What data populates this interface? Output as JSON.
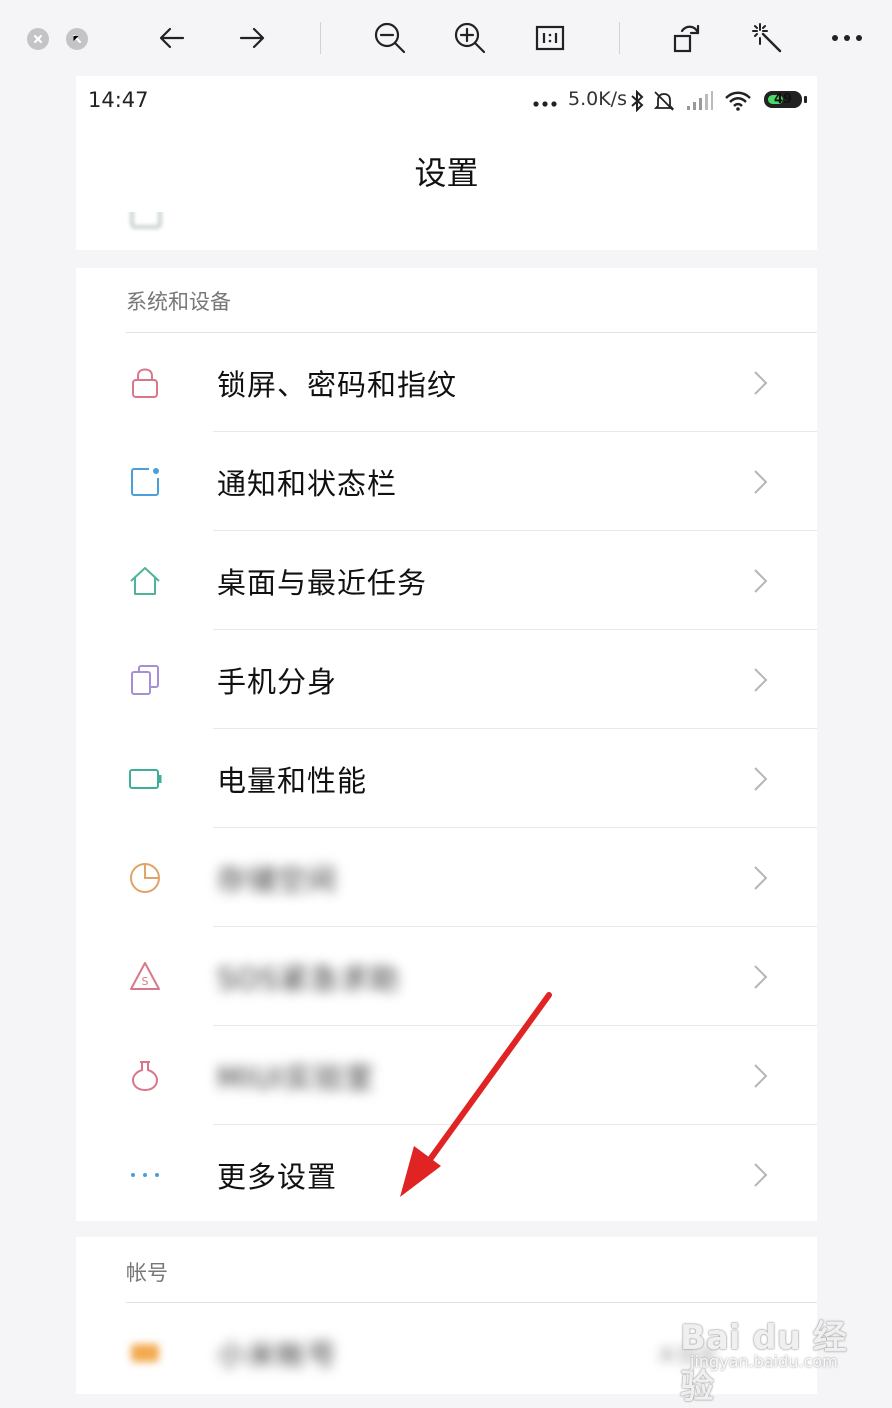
{
  "viewer": {
    "buttons": [
      "close",
      "minimize",
      "back",
      "forward",
      "zoom-out",
      "zoom-in",
      "actual-size",
      "rotate",
      "enhance",
      "more"
    ]
  },
  "status_bar": {
    "time": "14:47",
    "network_speed": "5.0K/s",
    "battery_level": "49",
    "battery_fraction": 0.49
  },
  "header": {
    "title": "设置"
  },
  "sections": {
    "system": {
      "header": "系统和设备",
      "items": [
        {
          "label": "锁屏、密码和指纹",
          "icon": "lock-icon",
          "color": "#d9778a"
        },
        {
          "label": "通知和状态栏",
          "icon": "notification-icon",
          "color": "#4a9fd8"
        },
        {
          "label": "桌面与最近任务",
          "icon": "home-icon",
          "color": "#4fb59a"
        },
        {
          "label": "手机分身",
          "icon": "clone-icon",
          "color": "#a58fd6"
        },
        {
          "label": "电量和性能",
          "icon": "battery-icon",
          "color": "#3fae9a"
        },
        {
          "label": "存储空间",
          "icon": "storage-icon",
          "color": "#e0a36a"
        },
        {
          "label": "SOS紧急求助",
          "icon": "sos-icon",
          "color": "#d9778a"
        },
        {
          "label": "MIUI实验室",
          "icon": "lab-flask-icon",
          "color": "#d9778a"
        },
        {
          "label": "更多设置",
          "icon": "more-dots-icon",
          "color": "#4a9fd8"
        }
      ]
    },
    "account": {
      "header": "帐号",
      "items": [
        {
          "label": "小米帐号",
          "icon": "mi-account-icon",
          "color": "#f3a94e",
          "value": "未登录"
        }
      ]
    }
  },
  "watermark": {
    "main": "Bai du 经验",
    "sub": "jingyan.baidu.com"
  },
  "colors": {
    "arrow": "#e02424",
    "chevron": "#b5b5b5",
    "stripe_yellow": "#f2e4b4",
    "stripe_blue": "#bdd7ea",
    "stripe_pink": "#e8c4cf"
  }
}
